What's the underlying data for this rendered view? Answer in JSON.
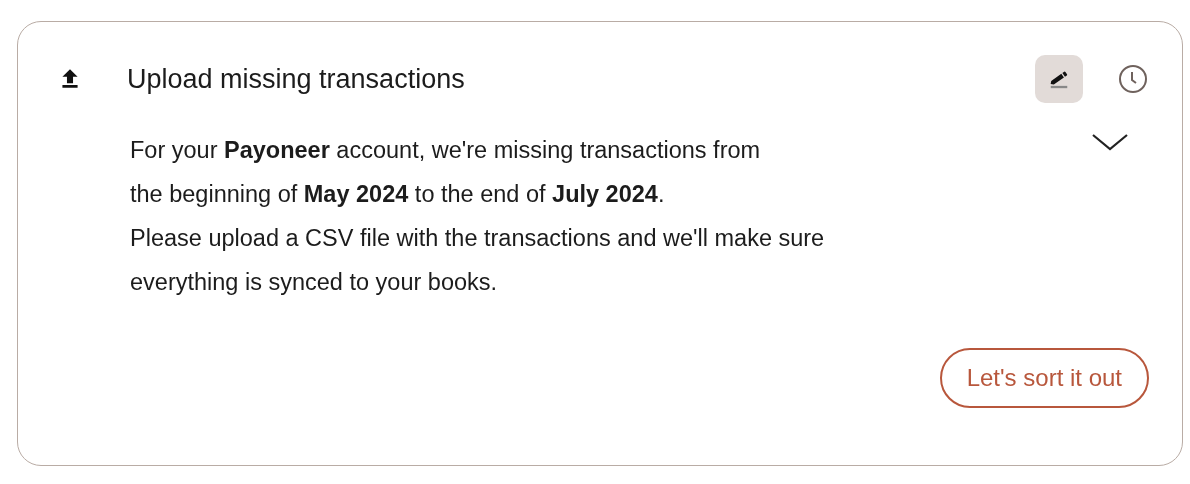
{
  "card": {
    "title": "Upload missing transactions",
    "expanded": true,
    "message_lines": [
      "For your **Payoneer** account, we're missing transactions from",
      "the beginning of **May 2024** to the end of **July 2024**.",
      "Please upload a CSV file with the transactions and we'll make sure",
      "everything is synced to your books."
    ],
    "action_button": "Let's sort it out"
  }
}
